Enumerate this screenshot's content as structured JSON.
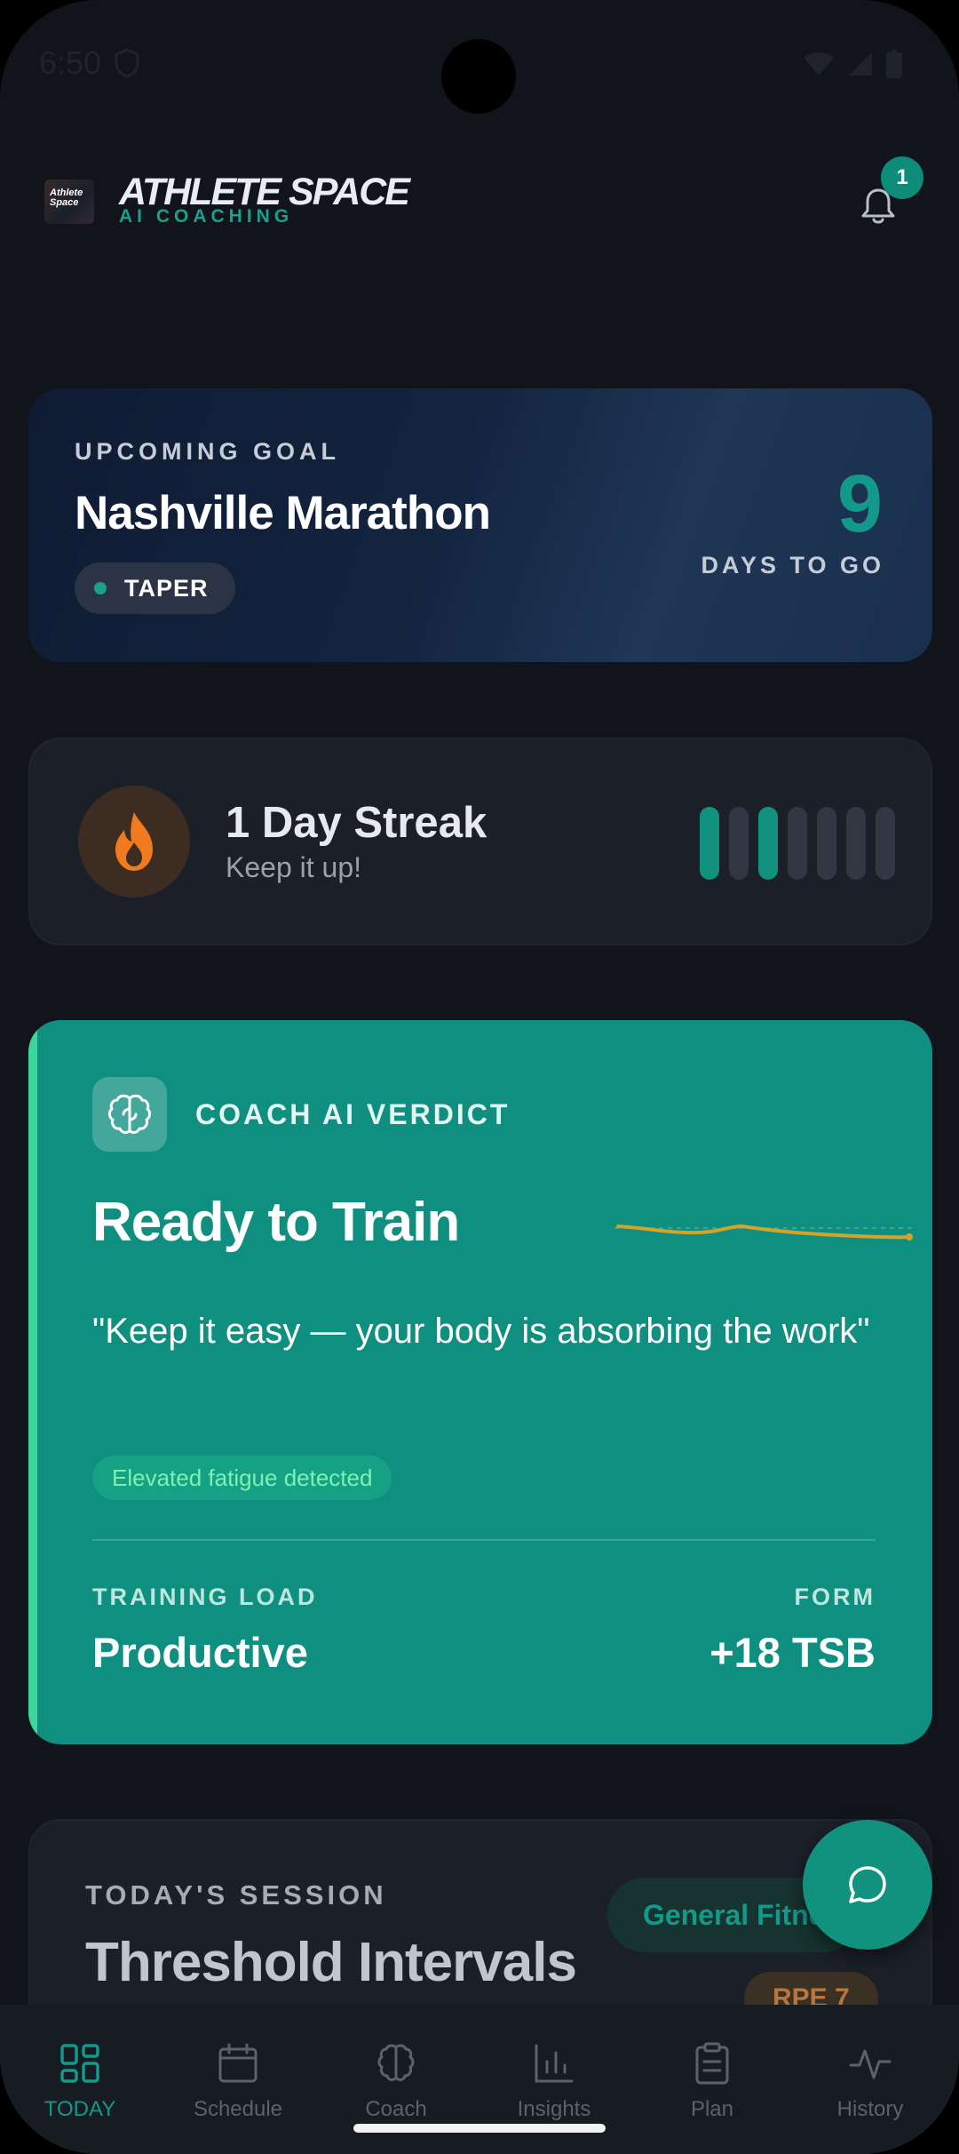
{
  "status": {
    "time": "6:50"
  },
  "header": {
    "brand": "ATHLETE SPACE",
    "brand_sub": "AI COACHING",
    "logo_text": "Athlete Space",
    "notification_count": "1"
  },
  "goal": {
    "eyebrow": "UPCOMING GOAL",
    "title": "Nashville Marathon",
    "phase": "TAPER",
    "days_number": "9",
    "days_label": "DAYS TO GO"
  },
  "streak": {
    "title": "1 Day Streak",
    "subtitle": "Keep it up!",
    "days": [
      true,
      false,
      true,
      false,
      false,
      false,
      false
    ]
  },
  "verdict": {
    "eyebrow": "COACH AI VERDICT",
    "title": "Ready to Train",
    "quote": "\"Keep it easy — your body is absorbing the work\"",
    "fatigue_tag": "Elevated fatigue detected",
    "training_load_label": "TRAINING LOAD",
    "training_load_value": "Productive",
    "form_label": "FORM",
    "form_value": "+18 TSB"
  },
  "session": {
    "eyebrow": "TODAY'S SESSION",
    "title": "Threshold Intervals",
    "tag": "General Fitne",
    "rpe": "RPE 7"
  },
  "nav": {
    "items": [
      {
        "label": "TODAY",
        "icon": "grid-icon"
      },
      {
        "label": "Schedule",
        "icon": "calendar-icon"
      },
      {
        "label": "Coach",
        "icon": "brain-icon"
      },
      {
        "label": "Insights",
        "icon": "bar-chart-icon"
      },
      {
        "label": "Plan",
        "icon": "clipboard-icon"
      },
      {
        "label": "History",
        "icon": "activity-icon"
      }
    ]
  },
  "colors": {
    "accent": "#10927f",
    "verdict_bg": "#0f8f80",
    "background": "#11141a",
    "flame": "#f07a1d",
    "sparkline": "#d4a42a"
  }
}
